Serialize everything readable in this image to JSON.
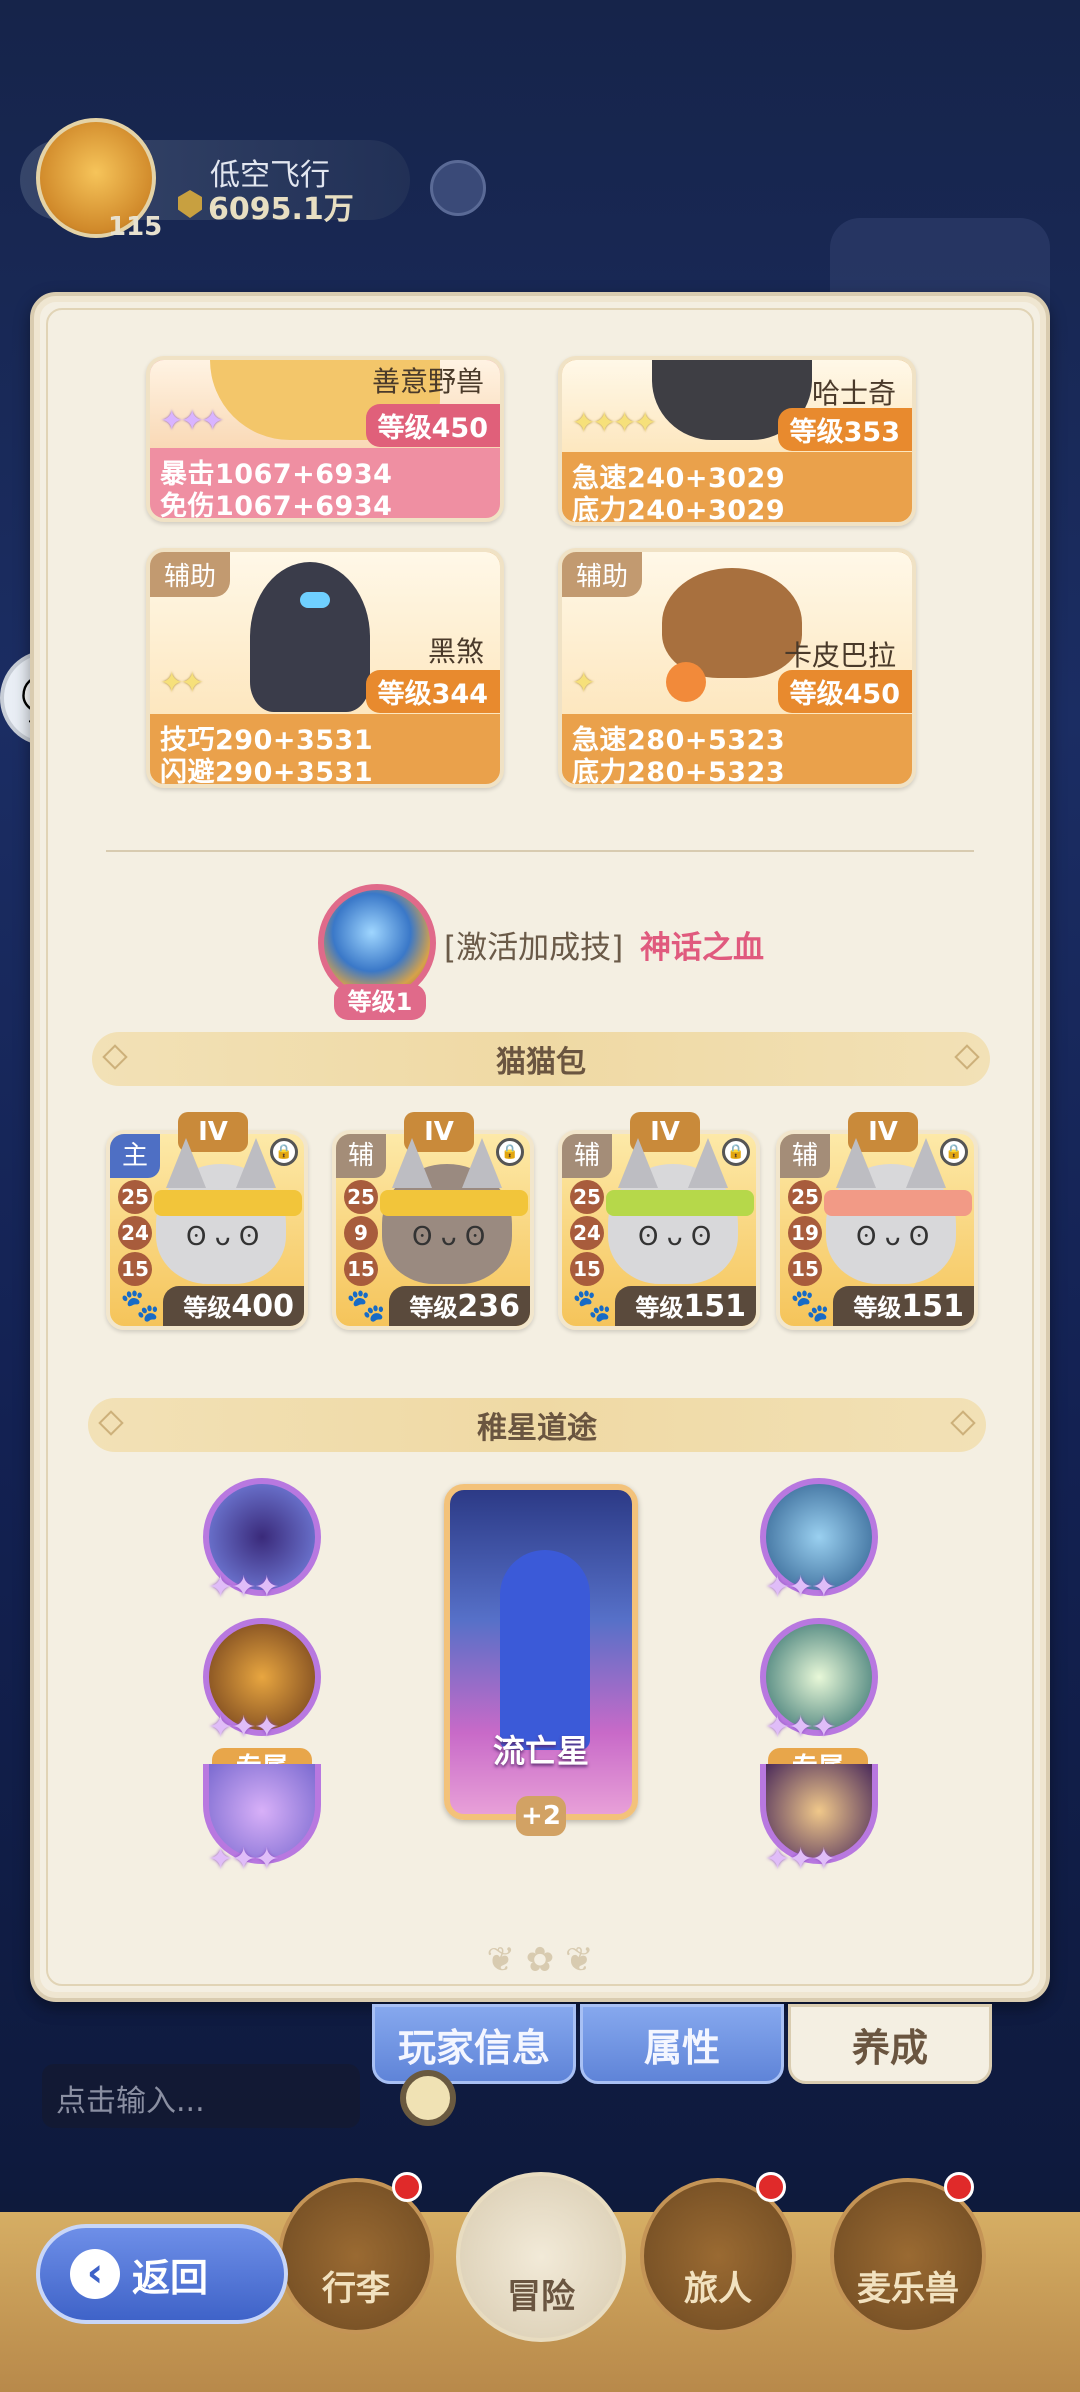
{
  "player": {
    "level": "115",
    "name": "低空飞行",
    "power": "6095.1万"
  },
  "pets": [
    {
      "tag": "",
      "name": "善意野兽",
      "level": "等级450",
      "stars": "✦✦✦",
      "stat1": "暴击1067+6934",
      "stat2": "免伤1067+6934",
      "color": "pink"
    },
    {
      "tag": "",
      "name": "哈士奇",
      "level": "等级353",
      "stars": "✦✦✦✦",
      "stat1": "急速240+3029",
      "stat2": "底力240+3029",
      "color": "orange"
    },
    {
      "tag": "辅助",
      "name": "黑煞",
      "level": "等级344",
      "stars": "✦✦",
      "stat1": "技巧290+3531",
      "stat2": "闪避290+3531",
      "color": "orange"
    },
    {
      "tag": "辅助",
      "name": "卡皮巴拉",
      "level": "等级450",
      "stars": "✦",
      "stat1": "急速280+5323",
      "stat2": "底力280+5323",
      "color": "orange"
    }
  ],
  "bonus_skill": {
    "label": "[激活加成技]",
    "name": "神话之血",
    "level": "等级1"
  },
  "cat_bag": {
    "title": "猫猫包",
    "items": [
      {
        "role": "主",
        "grade": "IV",
        "n1": "25",
        "n2": "24",
        "n3": "15",
        "level_prefix": "等级",
        "level": "400",
        "band": "#f2c53a"
      },
      {
        "role": "辅",
        "grade": "IV",
        "n1": "25",
        "n2": "9",
        "n3": "15",
        "level_prefix": "等级",
        "level": "236",
        "band": "#f2c53a"
      },
      {
        "role": "辅",
        "grade": "IV",
        "n1": "25",
        "n2": "24",
        "n3": "15",
        "level_prefix": "等级",
        "level": "151",
        "band": "#b6d84a"
      },
      {
        "role": "辅",
        "grade": "IV",
        "n1": "25",
        "n2": "19",
        "n3": "15",
        "level_prefix": "等级",
        "level": "151",
        "band": "#f29a86"
      }
    ]
  },
  "star_path": {
    "title": "稚星道途",
    "card_name": "流亡星",
    "plus": "+2",
    "exclusive_label": "专属",
    "orb_stars": "✦✦✦"
  },
  "tabs": [
    "玩家信息",
    "属性",
    "养成"
  ],
  "chat": {
    "placeholder": "点击输入..."
  },
  "nav": [
    "行李",
    "冒险",
    "旅人",
    "麦乐兽"
  ],
  "back_label": "返回",
  "colors": {
    "panel_bg": "#f4efe2",
    "pink_card": "#ef8fa2",
    "orange_card": "#eaa14b",
    "skill_pink": "#e05a7e",
    "tab_blue": "#6f8fe0"
  }
}
